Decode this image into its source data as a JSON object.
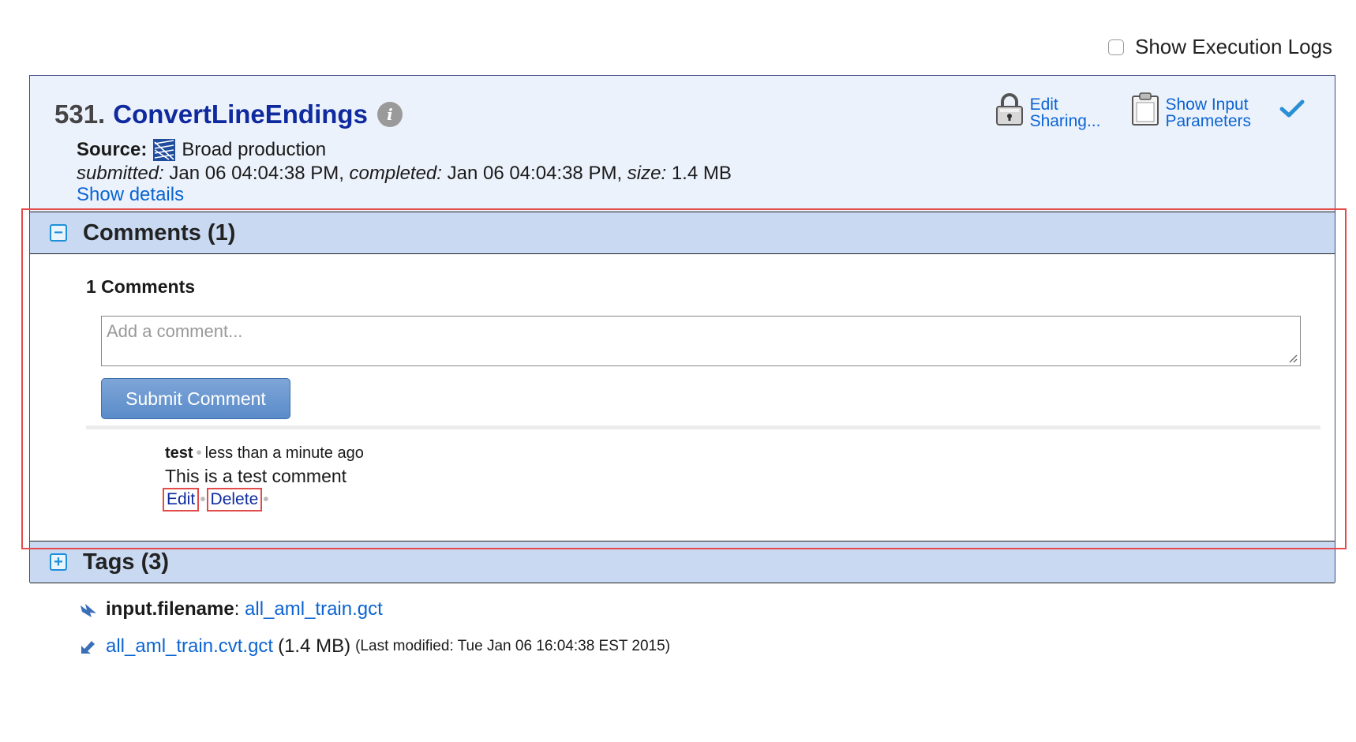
{
  "execution_logs": {
    "label": "Show Execution Logs",
    "checked": false
  },
  "job": {
    "number": "531.",
    "name": "ConvertLineEndings",
    "source_label": "Source:",
    "source_value": "Broad production",
    "submitted_label": "submitted:",
    "submitted_value": "Jan 06 04:04:38 PM,",
    "completed_label": "completed:",
    "completed_value": "Jan 06 04:04:38 PM,",
    "size_label": "size:",
    "size_value": "1.4 MB",
    "show_details": "Show details",
    "actions": {
      "edit_sharing": [
        "Edit",
        "Sharing..."
      ],
      "show_input": [
        "Show Input",
        "Parameters"
      ]
    }
  },
  "comments_section": {
    "title": "Comments (1)",
    "count_label": "1 Comments",
    "input_placeholder": "Add a comment...",
    "submit_label": "Submit Comment",
    "items": [
      {
        "author": "test",
        "time": "less than a minute ago",
        "text": "This is a test comment",
        "edit_label": "Edit",
        "delete_label": "Delete"
      }
    ]
  },
  "tags_section": {
    "title": "Tags (3)"
  },
  "files": {
    "input_label": "input.filename",
    "input_value": "all_aml_train.gct",
    "output_name": "all_aml_train.cvt.gct",
    "output_size": "(1.4 MB)",
    "output_modified": "(Last modified: Tue Jan 06 16:04:38 EST 2015)"
  },
  "colors": {
    "title_blue": "#0f2a9e",
    "link_blue": "#0b64d2",
    "section_bar": "#c9d9f2",
    "header_bg": "#ecf2fb",
    "highlight_red": "#e44b4b"
  }
}
